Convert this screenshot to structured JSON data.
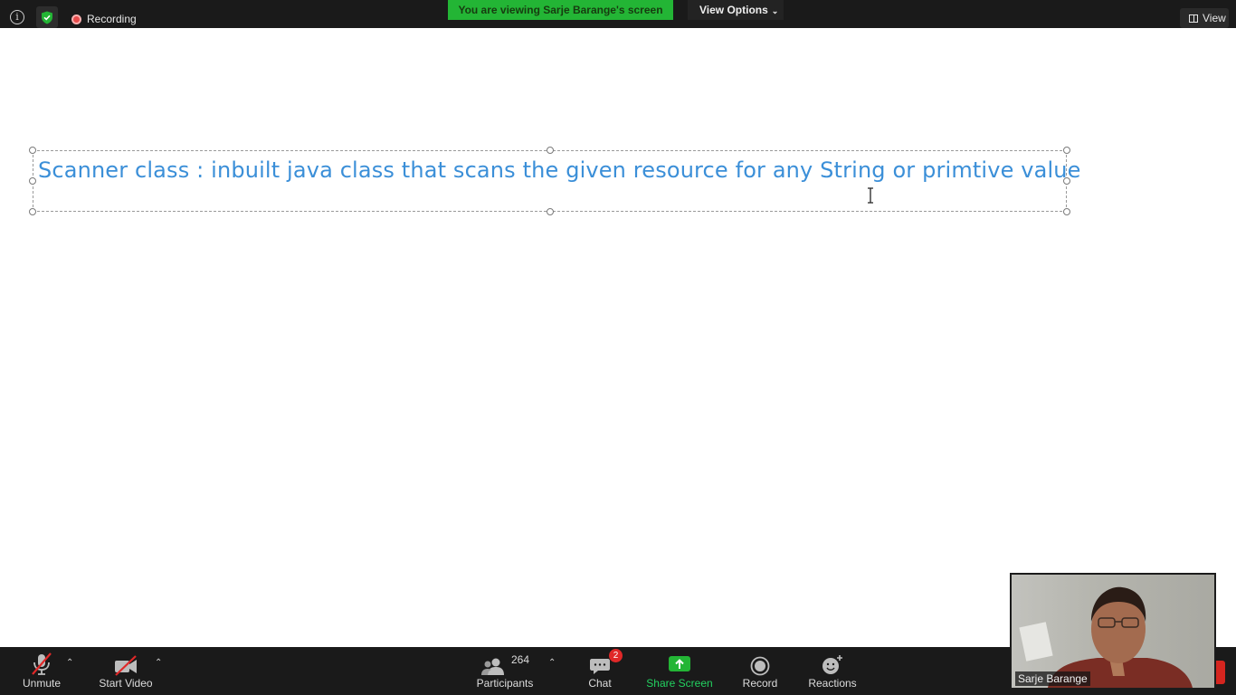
{
  "topbar": {
    "recording_label": "Recording",
    "viewing_banner": "You are viewing Sarje Barange's screen",
    "view_options_label": "View Options",
    "view_label": "View"
  },
  "slide": {
    "text": "Scanner class : inbuilt java class that scans the given resource for any String or primtive value",
    "text_color": "#3b8fd8"
  },
  "toolbar": {
    "unmute_label": "Unmute",
    "start_video_label": "Start Video",
    "participants_label": "Participants",
    "participants_count": "264",
    "chat_label": "Chat",
    "chat_badge": "2",
    "share_screen_label": "Share Screen",
    "record_label": "Record",
    "reactions_label": "Reactions"
  },
  "video_tile": {
    "name": "Sarje Barange"
  },
  "colors": {
    "banner_green": "#23b535",
    "toolbar_bg": "#1a1a1a",
    "mute_red": "#e02828"
  }
}
